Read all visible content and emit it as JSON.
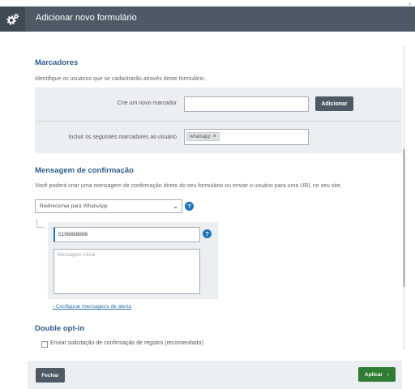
{
  "window": {
    "title_prefix": "Adicionar novo ",
    "title_highlight": "formulário",
    "close_glyph": "×"
  },
  "markers": {
    "title": "Marcadores",
    "description": "Identifique os usuários que se cadastrarão através deste formulário.",
    "new_marker_label": "Crie um novo marcador",
    "new_marker_value": "",
    "add_button": "Adicionar",
    "include_label": "Incluir os seguintes marcadores ao usuário",
    "tags": [
      "whatsapp"
    ],
    "tag_remove_glyph": "×"
  },
  "confirmation": {
    "title": "Mensagem de confirmação",
    "description": "Você poderá criar uma mensagem de confirmação direto do seu formulário ou enviar o usuário para uma URL no seu site.",
    "select_value": "Redirecionar para WhatsApp",
    "phone_value": "5198888888",
    "message_placeholder": "Mensagem inicial",
    "alert_link": "Configurar mensagens de alerta",
    "help_glyph": "?"
  },
  "double_optin": {
    "title": "Double opt-in",
    "checkbox_label": "Enviar solicitação de confirmação de registro (recomendado)",
    "checked": false
  },
  "footer": {
    "close_button": "Fechar",
    "apply_button": "Aplicar",
    "apply_arrow": "›"
  },
  "colors": {
    "titlebar": "#4d5a66",
    "accent_blue": "#1f73b7",
    "apply_green": "#2e7d32",
    "section_title": "#2f5b8a"
  }
}
